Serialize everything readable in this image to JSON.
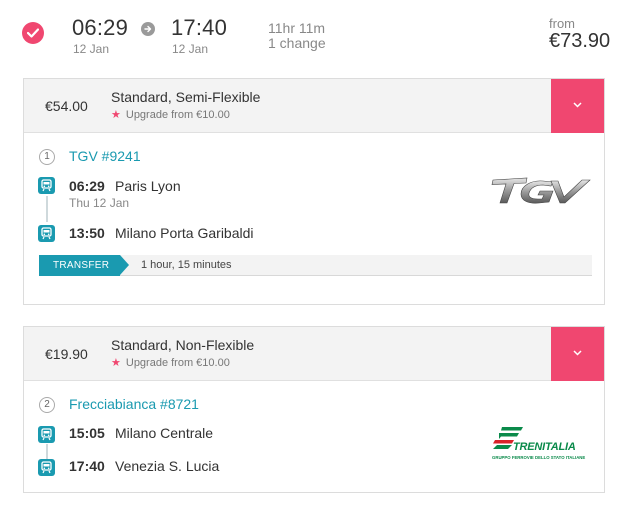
{
  "summary": {
    "depart_time": "06:29",
    "depart_date": "12 Jan",
    "arrive_time": "17:40",
    "arrive_date": "12 Jan",
    "duration": "11hr 11m",
    "changes": "1 change",
    "from_label": "from",
    "price": "€73.90"
  },
  "fares": [
    {
      "price": "€54.00",
      "name": "Standard, Semi-Flexible",
      "upgrade": "Upgrade from €10.00",
      "leg_number": "1",
      "train": "TGV #9241",
      "departure": {
        "time": "06:29",
        "station": "Paris Lyon",
        "date": "Thu 12 Jan"
      },
      "arrival": {
        "time": "13:50",
        "station": "Milano Porta Garibaldi"
      },
      "transfer_label": "TRANSFER",
      "transfer_duration": "1 hour, 15 minutes",
      "logo_text": "TGV"
    },
    {
      "price": "€19.90",
      "name": "Standard, Non-Flexible",
      "upgrade": "Upgrade from €10.00",
      "leg_number": "2",
      "train": "Frecciabianca #8721",
      "departure": {
        "time": "15:05",
        "station": "Milano Centrale"
      },
      "arrival": {
        "time": "17:40",
        "station": "Venezia S. Lucia"
      },
      "logo_text": "TRENITALIA",
      "logo_subtext": "GRUPPO FERROVIE DELLO STATO ITALIANE"
    }
  ],
  "colors": {
    "accent_pink": "#f04770",
    "teal": "#1a9ab0",
    "trenitalia_green": "#0a8a4a",
    "trenitalia_red": "#d8232a"
  },
  "icons": {
    "selected": "check-circle-icon",
    "arrow": "arrow-right-circle-icon",
    "toggle": "chevron-down-icon",
    "stop": "train-icon",
    "upgrade": "star-icon"
  }
}
